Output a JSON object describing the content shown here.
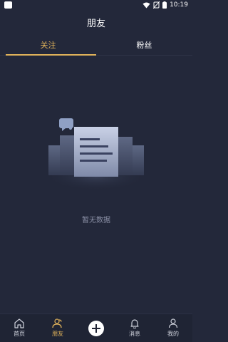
{
  "status_bar": {
    "time": "10:19",
    "icons": [
      "app-square-icon",
      "wifi-icon",
      "no-sim-icon",
      "battery-icon"
    ]
  },
  "header": {
    "title": "朋友"
  },
  "tabs": [
    {
      "label": "关注",
      "active": true
    },
    {
      "label": "粉丝",
      "active": false
    }
  ],
  "empty_state": {
    "message": "暂无数据",
    "illustration_icon": "empty-document-icon"
  },
  "bottom_nav": {
    "items": [
      {
        "label": "首页",
        "icon": "home-icon",
        "active": false
      },
      {
        "label": "朋友",
        "icon": "friends-icon",
        "active": true
      },
      {
        "label": "",
        "icon": "add-icon",
        "active": false
      },
      {
        "label": "消息",
        "icon": "bell-icon",
        "active": false
      },
      {
        "label": "我的",
        "icon": "user-icon",
        "active": false
      }
    ]
  },
  "colors": {
    "background": "#23283a",
    "accent": "#e0b25a",
    "nav_background": "#1f2434",
    "muted_text": "#8b90a6"
  }
}
